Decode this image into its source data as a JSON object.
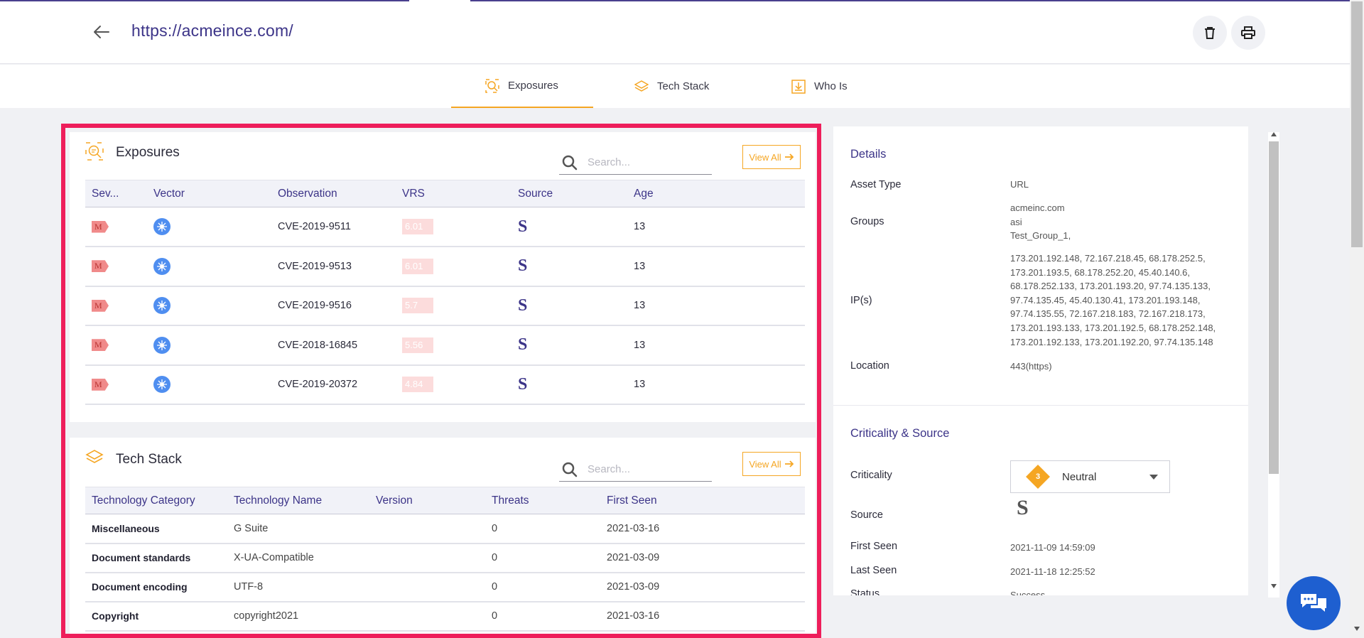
{
  "header": {
    "url_title": "https://acmeince.com/"
  },
  "tabs": [
    {
      "label": "Exposures",
      "icon": "exposures-icon",
      "active": true
    },
    {
      "label": "Tech Stack",
      "icon": "layers-icon",
      "active": false
    },
    {
      "label": "Who Is",
      "icon": "whois-icon",
      "active": false
    }
  ],
  "exposures": {
    "title": "Exposures",
    "search_placeholder": "Search...",
    "view_all": "View All",
    "columns": [
      "Sev...",
      "Vector",
      "Observation",
      "VRS",
      "Source",
      "Age"
    ],
    "rows": [
      {
        "sev": "M",
        "observation": "CVE-2019-9511",
        "vrs": "6.01",
        "source": "S",
        "age": "13"
      },
      {
        "sev": "M",
        "observation": "CVE-2019-9513",
        "vrs": "6.01",
        "source": "S",
        "age": "13"
      },
      {
        "sev": "M",
        "observation": "CVE-2019-9516",
        "vrs": "5.7",
        "source": "S",
        "age": "13"
      },
      {
        "sev": "M",
        "observation": "CVE-2018-16845",
        "vrs": "5.56",
        "source": "S",
        "age": "13"
      },
      {
        "sev": "M",
        "observation": "CVE-2019-20372",
        "vrs": "4.84",
        "source": "S",
        "age": "13"
      }
    ]
  },
  "tech_stack": {
    "title": "Tech Stack",
    "search_placeholder": "Search...",
    "view_all": "View All",
    "columns": [
      "Technology Category",
      "Technology Name",
      "Version",
      "Threats",
      "First Seen"
    ],
    "rows": [
      {
        "category": "Miscellaneous",
        "name": "G Suite",
        "version": "",
        "threats": "0",
        "first_seen": "2021-03-16"
      },
      {
        "category": "Document standards",
        "name": "X-UA-Compatible",
        "version": "",
        "threats": "0",
        "first_seen": "2021-03-09"
      },
      {
        "category": "Document encoding",
        "name": "UTF-8",
        "version": "",
        "threats": "0",
        "first_seen": "2021-03-09"
      },
      {
        "category": "Copyright",
        "name": "copyright2021",
        "version": "",
        "threats": "0",
        "first_seen": "2021-03-16"
      }
    ]
  },
  "details": {
    "title": "Details",
    "asset_type_label": "Asset Type",
    "asset_type": "URL",
    "groups_label": "Groups",
    "groups": [
      "acmeinc.com",
      "asi",
      "Test_Group_1,"
    ],
    "ips_label": "IP(s)",
    "ips": [
      "173.201.192.148, 72.167.218.45, 68.178.252.5,",
      "173.201.193.5, 68.178.252.20, 45.40.140.6,",
      "68.178.252.133, 173.201.193.20, 97.74.135.133,",
      "97.74.135.45, 45.40.130.41, 173.201.193.148,",
      "97.74.135.55, 72.167.218.183, 72.167.218.173,",
      "173.201.193.133, 173.201.192.5, 68.178.252.148,",
      "173.201.192.133, 173.201.192.20, 97.74.135.148"
    ],
    "location_label": "Location",
    "location": "443(https)"
  },
  "criticality_source": {
    "title": "Criticality & Source",
    "criticality_label": "Criticality",
    "criticality_level": "3",
    "criticality_value": "Neutral",
    "source_label": "Source",
    "source_value": "S",
    "first_seen_label": "First Seen",
    "first_seen": "2021-11-09 14:59:09",
    "last_seen_label": "Last Seen",
    "last_seen": "2021-11-18 12:25:52",
    "status_label": "Status",
    "status": "Success"
  },
  "colors": {
    "brand": "#3c3488",
    "accent": "#f5a623",
    "highlight_border": "#ee1e5b",
    "chat": "#1e5fd0"
  }
}
